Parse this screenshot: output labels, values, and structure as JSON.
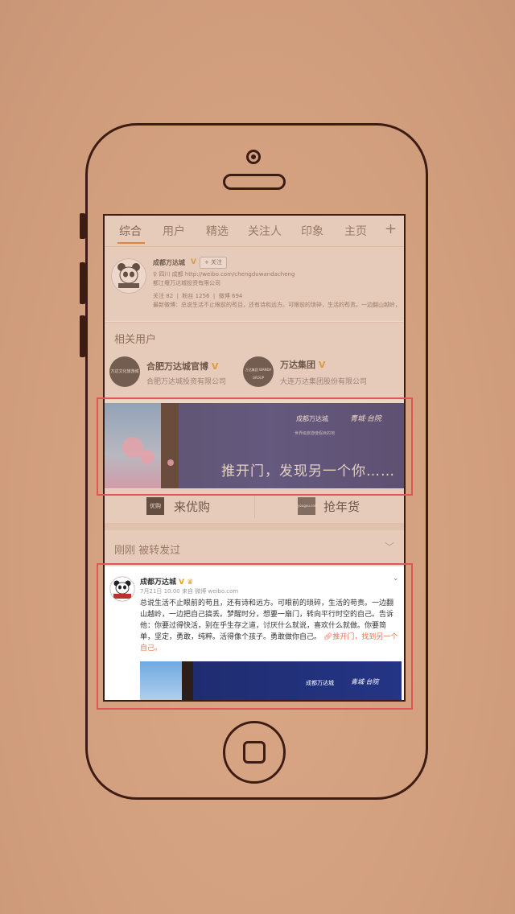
{
  "tabs": [
    "综合",
    "用户",
    "精选",
    "关注人",
    "印象",
    "主页",
    "+"
  ],
  "user_card": {
    "name": "成都万达城",
    "follow": "+ 关注",
    "location": "四川 成都",
    "url": "http://weibo.com/chengduwandacheng",
    "company": "都江堰万达城投资有限公司",
    "follows_label": "关注",
    "follows": "82",
    "fans_label": "粉丝",
    "fans": "1256",
    "weibo_label": "微博",
    "weibo": "694",
    "latest": "最新微博：总说生活不止眼前的苟且，还有诗和远方。可眼前的琐碎，生活的苟责。一边翻山越岭，一..."
  },
  "related": {
    "title": "相关用户",
    "items": [
      {
        "avatar_text": "万达文化旅游城",
        "name": "合肥万达城官博",
        "desc": "合肥万达城投资有限公司"
      },
      {
        "avatar_text": "万达集团 WANDA GROUP",
        "name": "万达集团",
        "desc": "大连万达集团股份有限公司"
      }
    ]
  },
  "banner": {
    "logo": "成都万达城",
    "logo2": "青城·台院",
    "sub": "世界级旅游度假目的地",
    "text": "推开门，发现另一个你……"
  },
  "shop": [
    {
      "icon": "优购",
      "label": "来优购"
    },
    {
      "icon": "yougou.com",
      "label": "抢年货"
    }
  ],
  "reposted": "刚刚 被转发过",
  "post": {
    "name": "成都万达城",
    "meta": "7月21日 10:00 来自 微博 weibo.com",
    "body": "总说生活不止眼前的苟且，还有诗和远方。可眼前的琐碎，生活的苟责。一边翻山越岭，一边把自己搞丢。梦醒时分，想要一扇门，转向平行时空的自己。告诉他：你要过得快活，别在乎生存之道，讨厌什么就说，喜欢什么就做。你要简单，坚定，勇敢，纯粹。活得像个孩子。勇敢做你自己。",
    "link": "推开门，找到另一个自己。",
    "img_logo": "成都万达城",
    "img_logo2": "青城·台院"
  },
  "colors": {
    "accent": "#e67e22",
    "highlight": "#e05555",
    "banner": "#243585"
  }
}
